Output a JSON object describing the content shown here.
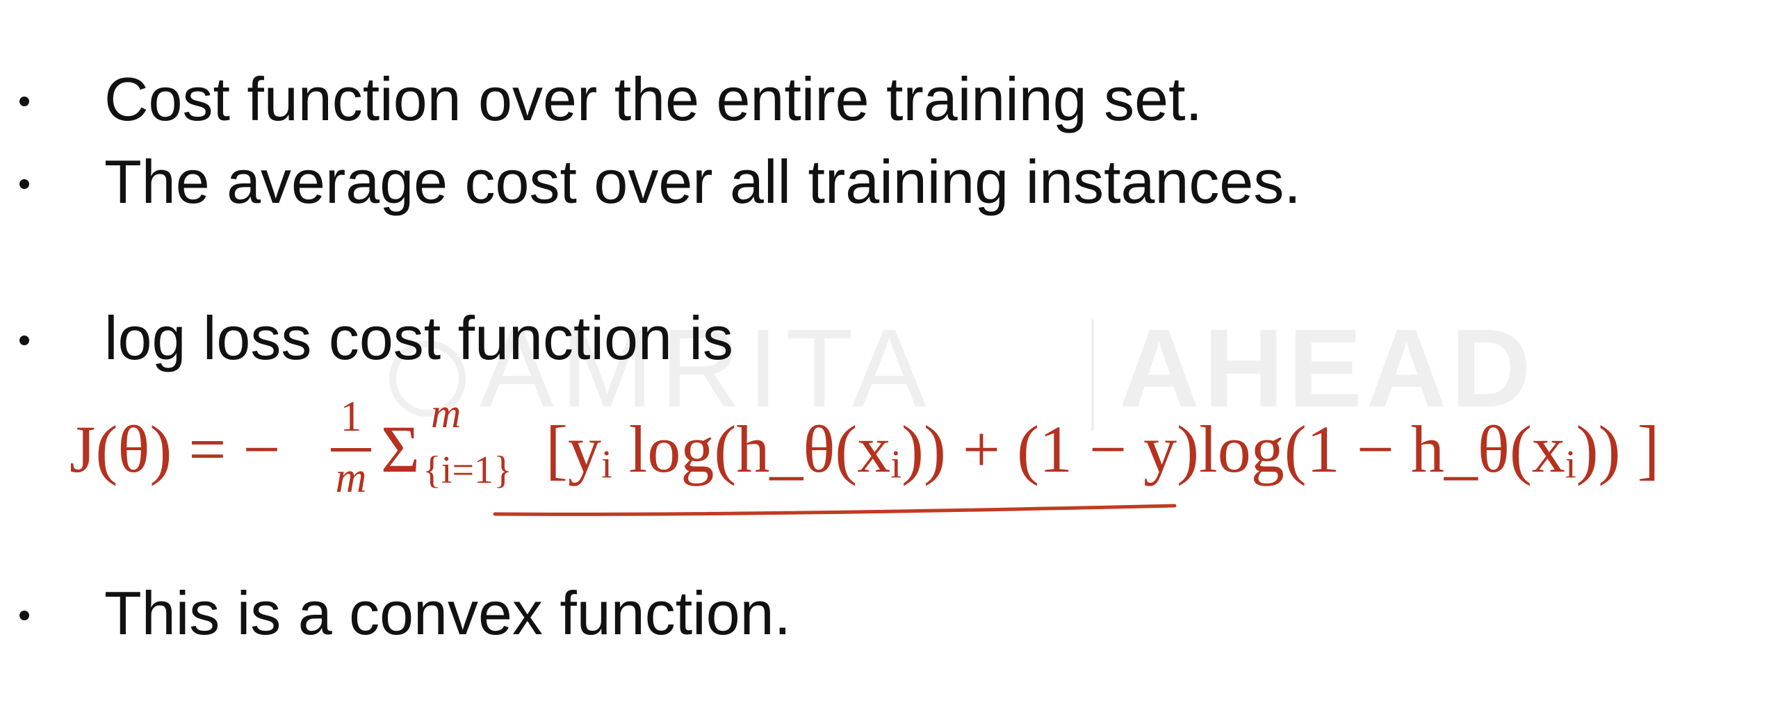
{
  "watermark": {
    "left_text": "AMRITA",
    "right_text": "AHEAD"
  },
  "bullets": [
    "Cost function over the entire training set.",
    "The average cost over all training instances.",
    "log loss cost function is",
    "This is a convex function."
  ],
  "formula": {
    "lhs": "J(θ) = −",
    "frac_num": "1",
    "frac_den": "m",
    "sigma": "Σ",
    "sum_upper": "m",
    "sum_lower": "{i=1}",
    "rhs": "[yᵢ log(h_θ(xᵢ)) + (1 − y)log(1 − h_θ(xᵢ)) ]"
  },
  "colors": {
    "text": "#111111",
    "formula": "#b5321f",
    "annotation_underline": "#c23a22"
  }
}
